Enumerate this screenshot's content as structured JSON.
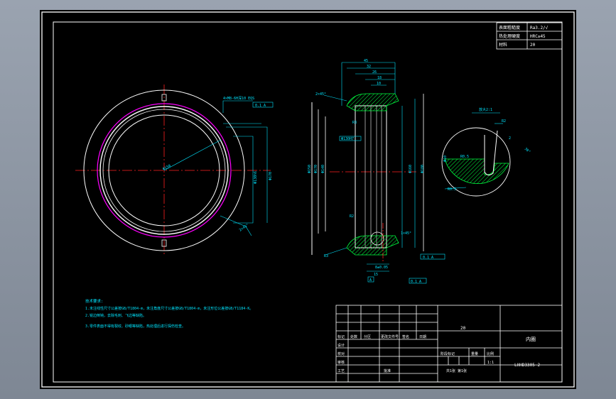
{
  "colors": {
    "frame": "#ffffff",
    "dimension": "#00e5ff",
    "centerline": "#ff2020",
    "highlight": "#ff00ff",
    "hatch": "#00ff40",
    "note_text": "#00e5ff",
    "table_text": "#ffffff"
  },
  "title_block_top": {
    "rows": [
      {
        "label": "表面粗糙度",
        "value": "Ra3.2/√"
      },
      {
        "label": "热处理硬度",
        "value": "HRC≥45"
      },
      {
        "label": "材料",
        "value": "20"
      }
    ]
  },
  "front_view": {
    "label_diameter": "Φ150",
    "label_top": "4×M8-6H深10 EQS",
    "label_box": "0.1 A",
    "label_vertical_1": "Φ130h6",
    "label_vertical_2": "Φ170",
    "label_bottom": "2×45°"
  },
  "section_view": {
    "top_dims": [
      "45",
      "32",
      "26",
      "18",
      "10"
    ],
    "left_labels": [
      "2×45°",
      "R3",
      "Φ130H7",
      "R2"
    ],
    "side_dims": [
      "Φ150",
      "Φ170",
      "Φ140",
      "Φ160",
      "Φ180"
    ],
    "bottom_labels": [
      "R3",
      "0.1 A",
      "8±0.05",
      "15",
      "0.1 A",
      "A"
    ],
    "chamfer": "1×45°"
  },
  "detail_view": {
    "title": "放大2:1",
    "labels": [
      "R2",
      "2",
      "Φ10",
      "R0.5",
      "30°",
      "R0.5"
    ]
  },
  "notes": {
    "title": "技术要求:",
    "line1": "1.未注线性尺寸公差按GB/T1804-m，未注角度尺寸公差按GB/T1804-m，未注形位公差按GB/T1184-K。",
    "line2": "2.锐边倒钝，去除毛刺、飞边等缺陷。",
    "line3": "3.零件表面不得有裂纹、砂眼等缺陷，热处理后进行探伤检查。"
  },
  "title_block": {
    "material": "20",
    "part_name": "内圈",
    "drawing_number": "LHHD3305-2",
    "row_labels": [
      "标记",
      "处数",
      "分区",
      "更改文件号",
      "签名",
      "日期"
    ],
    "left_labels": [
      "设计",
      "校对",
      "审核",
      "工艺"
    ],
    "stage_label": "阶段标记",
    "weight_label": "重量",
    "scale_label": "比例",
    "approve_label": "批准",
    "sheet_info": "共1张 第1张",
    "scale_value": "1:1"
  }
}
